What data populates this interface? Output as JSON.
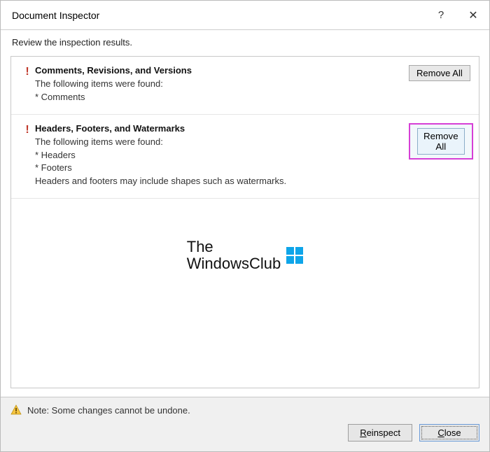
{
  "titlebar": {
    "title": "Document Inspector",
    "help_label": "?",
    "close_label": "✕"
  },
  "subtitle": "Review the inspection results.",
  "sections": [
    {
      "title": "Comments, Revisions, and Versions",
      "found_text": "The following items were found:",
      "items": [
        "* Comments"
      ],
      "extra": "",
      "remove_label": "Remove All",
      "highlighted": false
    },
    {
      "title": "Headers, Footers, and Watermarks",
      "found_text": "The following items were found:",
      "items": [
        "* Headers",
        "* Footers"
      ],
      "extra": "Headers and footers may include shapes such as watermarks.",
      "remove_label": "Remove All",
      "highlighted": true
    }
  ],
  "watermark": {
    "line1": "The",
    "line2": "WindowsClub"
  },
  "footer": {
    "note": "Note: Some changes cannot be undone.",
    "reinspect_label": "Reinspect",
    "reinspect_mnemonic": "R",
    "close_label": "Close",
    "close_mnemonic": "C"
  }
}
